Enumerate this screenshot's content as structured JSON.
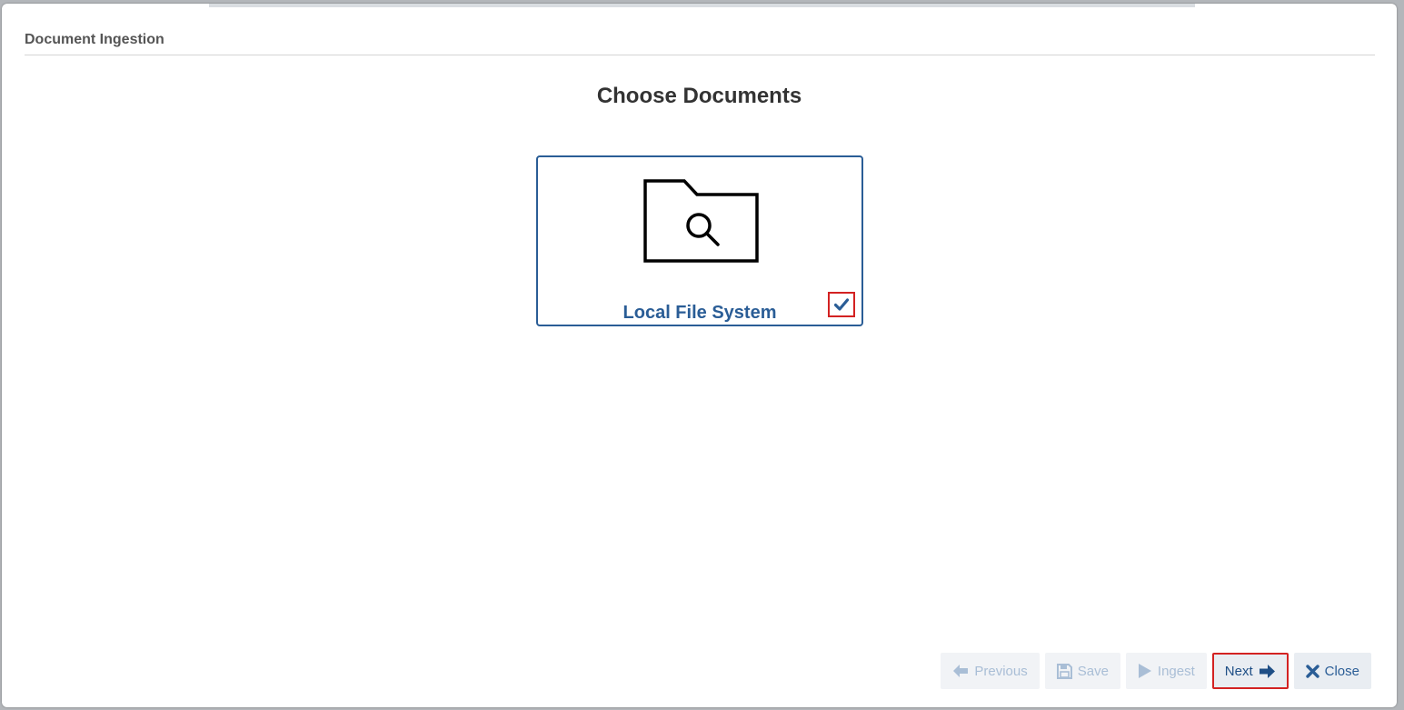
{
  "dialog": {
    "title": "Document Ingestion"
  },
  "page": {
    "heading": "Choose Documents"
  },
  "source_card": {
    "label": "Local File System",
    "selected": true
  },
  "footer": {
    "previous_label": "Previous",
    "save_label": "Save",
    "ingest_label": "Ingest",
    "next_label": "Next",
    "close_label": "Close"
  },
  "colors": {
    "accent": "#2a5d96",
    "highlight_border": "#d32222",
    "disabled_text": "#a9bed6"
  },
  "icons": {
    "card": "folder-search-icon",
    "check": "checkmark-icon",
    "previous": "arrow-left-icon",
    "save": "floppy-disk-icon",
    "ingest": "play-icon",
    "next": "arrow-right-icon",
    "close": "x-close-icon"
  }
}
